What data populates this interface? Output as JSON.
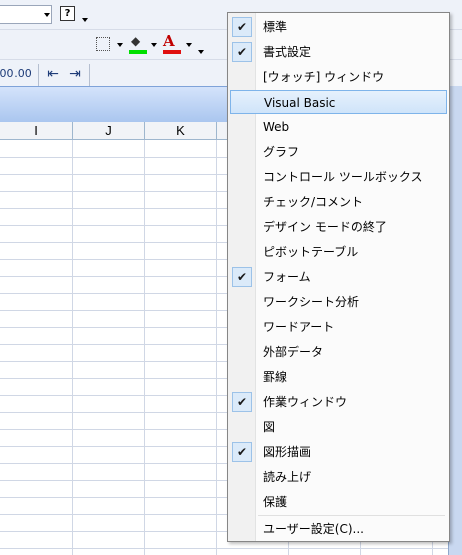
{
  "toolbar": {
    "help_glyph": "?",
    "decimal_inc": ".00",
    "decimal_dec": ".00",
    "indent_dec": "⇤",
    "indent_inc": "⇥",
    "fill_glyph": "◆",
    "font_color_glyph": "A"
  },
  "sheet": {
    "columns": [
      "I",
      "J",
      "K"
    ]
  },
  "menu": {
    "items": [
      {
        "label": "標準",
        "checked": true
      },
      {
        "label": "書式設定",
        "checked": true
      },
      {
        "label": "[ウォッチ] ウィンドウ",
        "checked": false
      },
      {
        "label": "Visual Basic",
        "checked": false,
        "highlighted": true
      },
      {
        "label": "Web",
        "checked": false
      },
      {
        "label": "グラフ",
        "checked": false
      },
      {
        "label": "コントロール ツールボックス",
        "checked": false
      },
      {
        "label": "チェック/コメント",
        "checked": false
      },
      {
        "label": "デザイン モードの終了",
        "checked": false
      },
      {
        "label": "ピボットテーブル",
        "checked": false
      },
      {
        "label": "フォーム",
        "checked": true
      },
      {
        "label": "ワークシート分析",
        "checked": false
      },
      {
        "label": "ワードアート",
        "checked": false
      },
      {
        "label": "外部データ",
        "checked": false
      },
      {
        "label": "罫線",
        "checked": false
      },
      {
        "label": "作業ウィンドウ",
        "checked": true
      },
      {
        "label": "図",
        "checked": false
      },
      {
        "label": "図形描画",
        "checked": true
      },
      {
        "label": "読み上げ",
        "checked": false
      },
      {
        "label": "保護",
        "checked": false
      }
    ],
    "customize_label": "ユーザー設定(C)...",
    "check_glyph": "✔"
  }
}
